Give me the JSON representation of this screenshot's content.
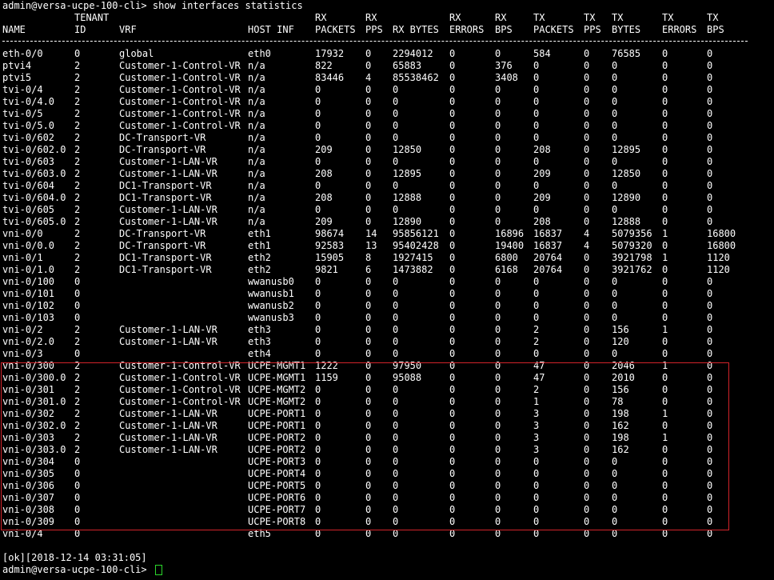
{
  "prompt": "admin@versa-ucpe-100-cli>",
  "command": "show interfaces statistics",
  "header_top": [
    "",
    "TENANT",
    "",
    "",
    "RX",
    "RX",
    "",
    "RX",
    "RX",
    "TX",
    "TX",
    "TX",
    "TX",
    "TX"
  ],
  "header_bottom": [
    "NAME",
    "ID",
    "VRF",
    "HOST INF",
    "PACKETS",
    "PPS",
    "RX BYTES",
    "ERRORS",
    "BPS",
    "PACKETS",
    "PPS",
    "BYTES",
    "ERRORS",
    "BPS"
  ],
  "rows": [
    [
      "eth-0/0",
      "0",
      "global",
      "eth0",
      "17932",
      "0",
      "2294012",
      "0",
      "0",
      "584",
      "0",
      "76585",
      "0",
      "0"
    ],
    [
      "ptvi4",
      "2",
      "Customer-1-Control-VR",
      "n/a",
      "822",
      "0",
      "65883",
      "0",
      "376",
      "0",
      "0",
      "0",
      "0",
      "0"
    ],
    [
      "ptvi5",
      "2",
      "Customer-1-Control-VR",
      "n/a",
      "83446",
      "4",
      "85538462",
      "0",
      "3408",
      "0",
      "0",
      "0",
      "0",
      "0"
    ],
    [
      "tvi-0/4",
      "2",
      "Customer-1-Control-VR",
      "n/a",
      "0",
      "0",
      "0",
      "0",
      "0",
      "0",
      "0",
      "0",
      "0",
      "0"
    ],
    [
      "tvi-0/4.0",
      "2",
      "Customer-1-Control-VR",
      "n/a",
      "0",
      "0",
      "0",
      "0",
      "0",
      "0",
      "0",
      "0",
      "0",
      "0"
    ],
    [
      "tvi-0/5",
      "2",
      "Customer-1-Control-VR",
      "n/a",
      "0",
      "0",
      "0",
      "0",
      "0",
      "0",
      "0",
      "0",
      "0",
      "0"
    ],
    [
      "tvi-0/5.0",
      "2",
      "Customer-1-Control-VR",
      "n/a",
      "0",
      "0",
      "0",
      "0",
      "0",
      "0",
      "0",
      "0",
      "0",
      "0"
    ],
    [
      "tvi-0/602",
      "2",
      "DC-Transport-VR",
      "n/a",
      "0",
      "0",
      "0",
      "0",
      "0",
      "0",
      "0",
      "0",
      "0",
      "0"
    ],
    [
      "tvi-0/602.0",
      "2",
      "DC-Transport-VR",
      "n/a",
      "209",
      "0",
      "12850",
      "0",
      "0",
      "208",
      "0",
      "12895",
      "0",
      "0"
    ],
    [
      "tvi-0/603",
      "2",
      "Customer-1-LAN-VR",
      "n/a",
      "0",
      "0",
      "0",
      "0",
      "0",
      "0",
      "0",
      "0",
      "0",
      "0"
    ],
    [
      "tvi-0/603.0",
      "2",
      "Customer-1-LAN-VR",
      "n/a",
      "208",
      "0",
      "12895",
      "0",
      "0",
      "209",
      "0",
      "12850",
      "0",
      "0"
    ],
    [
      "tvi-0/604",
      "2",
      "DC1-Transport-VR",
      "n/a",
      "0",
      "0",
      "0",
      "0",
      "0",
      "0",
      "0",
      "0",
      "0",
      "0"
    ],
    [
      "tvi-0/604.0",
      "2",
      "DC1-Transport-VR",
      "n/a",
      "208",
      "0",
      "12888",
      "0",
      "0",
      "209",
      "0",
      "12890",
      "0",
      "0"
    ],
    [
      "tvi-0/605",
      "2",
      "Customer-1-LAN-VR",
      "n/a",
      "0",
      "0",
      "0",
      "0",
      "0",
      "0",
      "0",
      "0",
      "0",
      "0"
    ],
    [
      "tvi-0/605.0",
      "2",
      "Customer-1-LAN-VR",
      "n/a",
      "209",
      "0",
      "12890",
      "0",
      "0",
      "208",
      "0",
      "12888",
      "0",
      "0"
    ],
    [
      "vni-0/0",
      "2",
      "DC-Transport-VR",
      "eth1",
      "98674",
      "14",
      "95856121",
      "0",
      "16896",
      "16837",
      "4",
      "5079356",
      "1",
      "16800"
    ],
    [
      "vni-0/0.0",
      "2",
      "DC-Transport-VR",
      "eth1",
      "92583",
      "13",
      "95402428",
      "0",
      "19400",
      "16837",
      "4",
      "5079320",
      "0",
      "16800"
    ],
    [
      "vni-0/1",
      "2",
      "DC1-Transport-VR",
      "eth2",
      "15905",
      "8",
      "1927415",
      "0",
      "6800",
      "20764",
      "0",
      "3921798",
      "1",
      "1120"
    ],
    [
      "vni-0/1.0",
      "2",
      "DC1-Transport-VR",
      "eth2",
      "9821",
      "6",
      "1473882",
      "0",
      "6168",
      "20764",
      "0",
      "3921762",
      "0",
      "1120"
    ],
    [
      "vni-0/100",
      "0",
      "",
      "wwanusb0",
      "0",
      "0",
      "0",
      "0",
      "0",
      "0",
      "0",
      "0",
      "0",
      "0"
    ],
    [
      "vni-0/101",
      "0",
      "",
      "wwanusb1",
      "0",
      "0",
      "0",
      "0",
      "0",
      "0",
      "0",
      "0",
      "0",
      "0"
    ],
    [
      "vni-0/102",
      "0",
      "",
      "wwanusb2",
      "0",
      "0",
      "0",
      "0",
      "0",
      "0",
      "0",
      "0",
      "0",
      "0"
    ],
    [
      "vni-0/103",
      "0",
      "",
      "wwanusb3",
      "0",
      "0",
      "0",
      "0",
      "0",
      "0",
      "0",
      "0",
      "0",
      "0"
    ],
    [
      "vni-0/2",
      "2",
      "Customer-1-LAN-VR",
      "eth3",
      "0",
      "0",
      "0",
      "0",
      "0",
      "2",
      "0",
      "156",
      "1",
      "0"
    ],
    [
      "vni-0/2.0",
      "2",
      "Customer-1-LAN-VR",
      "eth3",
      "0",
      "0",
      "0",
      "0",
      "0",
      "2",
      "0",
      "120",
      "0",
      "0"
    ],
    [
      "vni-0/3",
      "0",
      "",
      "eth4",
      "0",
      "0",
      "0",
      "0",
      "0",
      "0",
      "0",
      "0",
      "0",
      "0"
    ],
    [
      "vni-0/300",
      "2",
      "Customer-1-Control-VR",
      "UCPE-MGMT1",
      "1222",
      "0",
      "97950",
      "0",
      "0",
      "47",
      "0",
      "2046",
      "1",
      "0"
    ],
    [
      "vni-0/300.0",
      "2",
      "Customer-1-Control-VR",
      "UCPE-MGMT1",
      "1159",
      "0",
      "95088",
      "0",
      "0",
      "47",
      "0",
      "2010",
      "0",
      "0"
    ],
    [
      "vni-0/301",
      "2",
      "Customer-1-Control-VR",
      "UCPE-MGMT2",
      "0",
      "0",
      "0",
      "0",
      "0",
      "2",
      "0",
      "156",
      "0",
      "0"
    ],
    [
      "vni-0/301.0",
      "2",
      "Customer-1-Control-VR",
      "UCPE-MGMT2",
      "0",
      "0",
      "0",
      "0",
      "0",
      "1",
      "0",
      "78",
      "0",
      "0"
    ],
    [
      "vni-0/302",
      "2",
      "Customer-1-LAN-VR",
      "UCPE-PORT1",
      "0",
      "0",
      "0",
      "0",
      "0",
      "3",
      "0",
      "198",
      "1",
      "0"
    ],
    [
      "vni-0/302.0",
      "2",
      "Customer-1-LAN-VR",
      "UCPE-PORT1",
      "0",
      "0",
      "0",
      "0",
      "0",
      "3",
      "0",
      "162",
      "0",
      "0"
    ],
    [
      "vni-0/303",
      "2",
      "Customer-1-LAN-VR",
      "UCPE-PORT2",
      "0",
      "0",
      "0",
      "0",
      "0",
      "3",
      "0",
      "198",
      "1",
      "0"
    ],
    [
      "vni-0/303.0",
      "2",
      "Customer-1-LAN-VR",
      "UCPE-PORT2",
      "0",
      "0",
      "0",
      "0",
      "0",
      "3",
      "0",
      "162",
      "0",
      "0"
    ],
    [
      "vni-0/304",
      "0",
      "",
      "UCPE-PORT3",
      "0",
      "0",
      "0",
      "0",
      "0",
      "0",
      "0",
      "0",
      "0",
      "0"
    ],
    [
      "vni-0/305",
      "0",
      "",
      "UCPE-PORT4",
      "0",
      "0",
      "0",
      "0",
      "0",
      "0",
      "0",
      "0",
      "0",
      "0"
    ],
    [
      "vni-0/306",
      "0",
      "",
      "UCPE-PORT5",
      "0",
      "0",
      "0",
      "0",
      "0",
      "0",
      "0",
      "0",
      "0",
      "0"
    ],
    [
      "vni-0/307",
      "0",
      "",
      "UCPE-PORT6",
      "0",
      "0",
      "0",
      "0",
      "0",
      "0",
      "0",
      "0",
      "0",
      "0"
    ],
    [
      "vni-0/308",
      "0",
      "",
      "UCPE-PORT7",
      "0",
      "0",
      "0",
      "0",
      "0",
      "0",
      "0",
      "0",
      "0",
      "0"
    ],
    [
      "vni-0/309",
      "0",
      "",
      "UCPE-PORT8",
      "0",
      "0",
      "0",
      "0",
      "0",
      "0",
      "0",
      "0",
      "0",
      "0"
    ],
    [
      "vni-0/4",
      "0",
      "",
      "eth5",
      "0",
      "0",
      "0",
      "0",
      "0",
      "0",
      "0",
      "0",
      "0",
      "0"
    ]
  ],
  "status": "[ok][2018-12-14 03:31:05]",
  "colors": {
    "background": "#000000",
    "text": "#ffffff",
    "highlight_border": "#d2232a",
    "cursor": "#2bd62b"
  }
}
